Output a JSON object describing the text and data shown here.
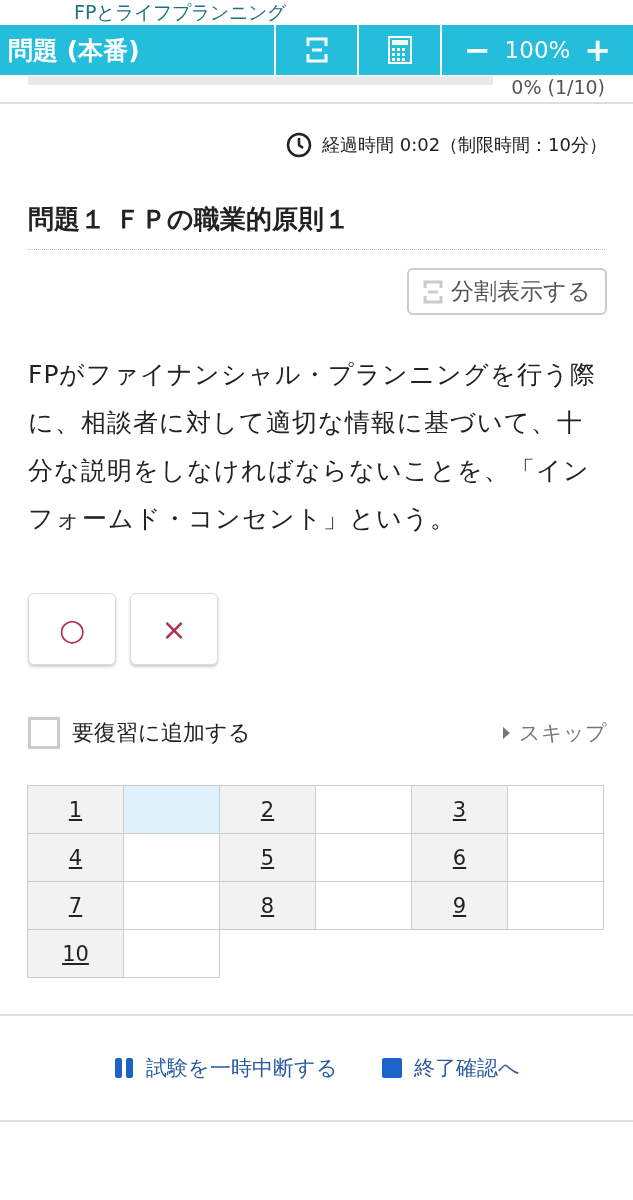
{
  "background_title": "FPとライフプランニング",
  "header": {
    "title": "問題 (本番)",
    "zoom_out": "−",
    "zoom": "100%",
    "zoom_in": "+"
  },
  "progress": {
    "level": 0,
    "reading": "0% (1/10)"
  },
  "timer": "経過時間 0:02（制限時間：10分）",
  "question": {
    "title": "問題１ ＦＰの職業的原則１",
    "split_button": "分割表示する",
    "text": "FPがファイナンシャル・プランニングを行う際に、相談者に対して適切な情報に基づいて、十分な説明をしなければならないことを、「インフォームド・コンセント」という。"
  },
  "answers": [
    {
      "label": "○",
      "selected": false
    },
    {
      "label": "×",
      "selected": false
    }
  ],
  "review": {
    "label": "要復習に追加する",
    "checked": false
  },
  "skip": "スキップ",
  "grid": [
    {
      "number": "1",
      "selected": true
    },
    {
      "number": "2",
      "selected": false
    },
    {
      "number": "3",
      "selected": false
    },
    {
      "number": "4",
      "selected": false
    },
    {
      "number": "5",
      "selected": false
    },
    {
      "number": "6",
      "selected": false
    },
    {
      "number": "7",
      "selected": false
    },
    {
      "number": "8",
      "selected": false
    },
    {
      "number": "9",
      "selected": false
    },
    {
      "number": "10",
      "selected": false
    }
  ],
  "footer": {
    "pause": "試験を一時中断する",
    "finish": "終了確認へ"
  }
}
